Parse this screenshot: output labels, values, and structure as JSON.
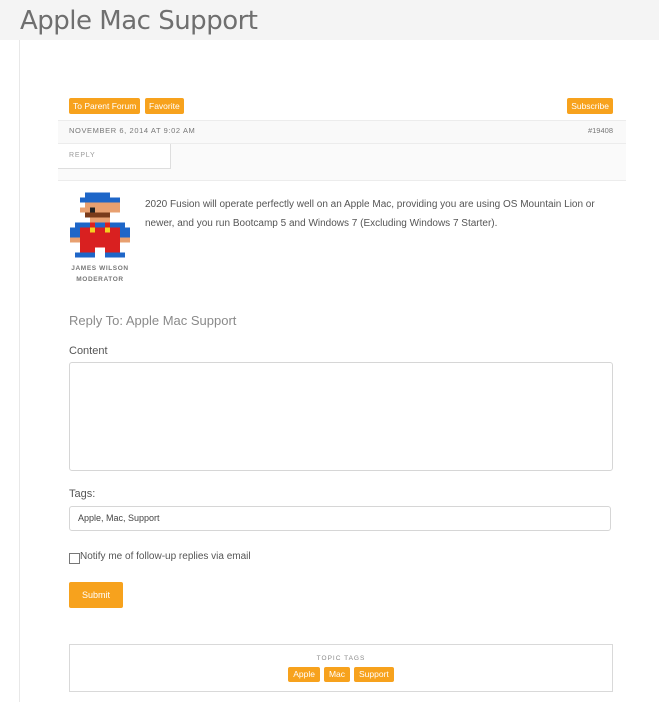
{
  "page": {
    "title": "Apple Mac Support"
  },
  "topic_actions": {
    "parent_forum": "To Parent Forum",
    "favorite": "Favorite",
    "subscribe": "Subscribe"
  },
  "post": {
    "date": "NOVEMBER 6, 2014 AT 9:02 AM",
    "id": "#19408",
    "reply_link": "REPLY",
    "author_name": "JAMES WILSON",
    "author_role": "MODERATOR",
    "content": "2020 Fusion will operate perfectly well on an Apple Mac, providing you are using OS Mountain Lion or newer, and you run Bootcamp 5 and Windows 7 (Excluding Windows 7 Starter)."
  },
  "reply_form": {
    "heading": "Reply To: Apple Mac Support",
    "content_label": "Content",
    "content_value": "",
    "tags_label": "Tags:",
    "tags_value": "Apple, Mac, Support",
    "notify_label": "Notify me of follow-up replies via email",
    "notify_checked": false,
    "submit_label": "Submit"
  },
  "topic_tags": {
    "title": "TOPIC TAGS",
    "tags": [
      "Apple",
      "Mac",
      "Support"
    ]
  },
  "colors": {
    "accent": "#f7a21d",
    "title": "#6f6f6f"
  },
  "icons": {
    "avatar": "pixel-character-avatar"
  }
}
